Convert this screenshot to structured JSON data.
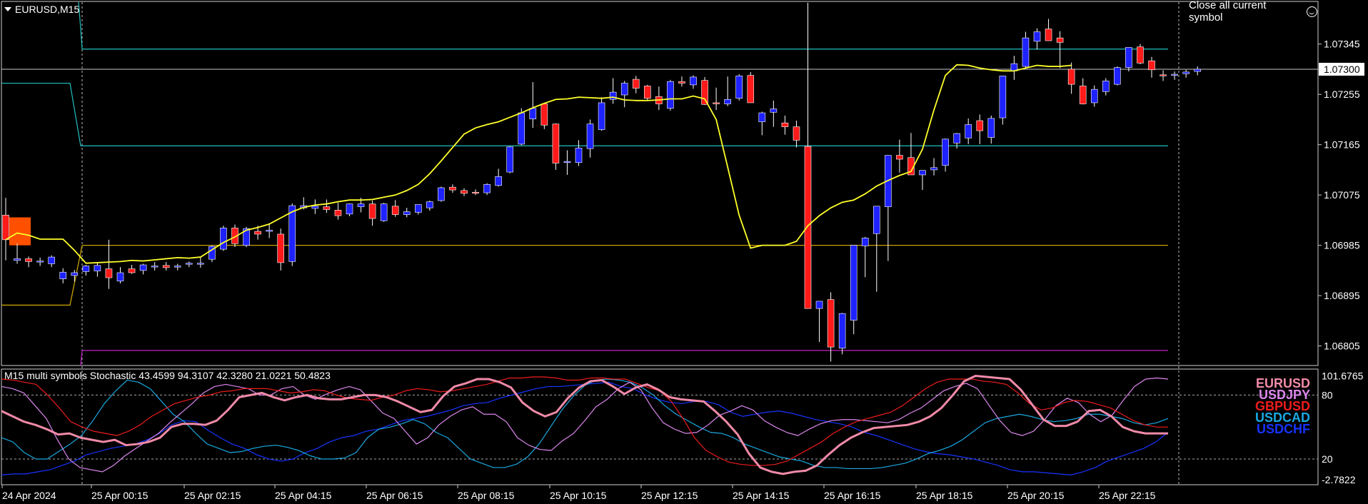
{
  "window": {
    "symbol_timeframe": "EURUSD,M15"
  },
  "toolbar": {
    "close_all_label": "Close all current symbol",
    "close_all_icon": "smiley-icon"
  },
  "price_axis": {
    "labels": [
      "1.07345",
      "1.07255",
      "1.07165",
      "1.07075",
      "1.06985",
      "1.06895",
      "1.06805"
    ],
    "current_price": "1.07300"
  },
  "time_axis": {
    "labels": [
      "24 Apr 2024",
      "25 Apr 00:15",
      "25 Apr 02:15",
      "25 Apr 04:15",
      "25 Apr 06:15",
      "25 Apr 08:15",
      "25 Apr 10:15",
      "25 Apr 12:15",
      "25 Apr 14:15",
      "25 Apr 16:15",
      "25 Apr 18:15",
      "25 Apr 20:15",
      "25 Apr 22:15"
    ]
  },
  "indicator": {
    "title": "M15 multi symbols Stochastic 43.4599 94.3107 42.3280 21.0221 50.4823",
    "axis_labels": [
      "101.6765",
      "80",
      "20",
      "-2.7822"
    ],
    "symbols": [
      {
        "name": "EURUSD",
        "color": "#f08aa8"
      },
      {
        "name": "USDJPY",
        "color": "#dd88ee"
      },
      {
        "name": "GBPUSD",
        "color": "#ee1c1c"
      },
      {
        "name": "USDCAD",
        "color": "#1aa8e0"
      },
      {
        "name": "USDCHF",
        "color": "#1733ff"
      }
    ]
  },
  "colors": {
    "bull": "#1e22ff",
    "bear": "#ff1a1a",
    "ma": "#ffff2a",
    "cyan": "#20c0c0",
    "gold": "#c8a000",
    "magenta": "#c020c0",
    "orange": "#ff5000"
  },
  "chart_data": {
    "type": "candlestick",
    "symbol": "EURUSD",
    "timeframe": "M15",
    "price_range": [
      1.0677,
      1.0742
    ],
    "candles_ohlc": [
      [
        1.07039,
        1.0707,
        1.06958,
        1.06995
      ],
      [
        1.06958,
        1.06988,
        1.06952,
        1.06961
      ],
      [
        1.06961,
        1.06965,
        1.06946,
        1.06956
      ],
      [
        1.06955,
        1.06963,
        1.06948,
        1.06957
      ],
      [
        1.06952,
        1.06967,
        1.06946,
        1.06964
      ],
      [
        1.06925,
        1.06944,
        1.06917,
        1.06937
      ],
      [
        1.06931,
        1.06941,
        1.0692,
        1.06936
      ],
      [
        1.06938,
        1.0695,
        1.06931,
        1.06948
      ],
      [
        1.06939,
        1.06954,
        1.06929,
        1.06949
      ],
      [
        1.06943,
        1.06995,
        1.06907,
        1.06927
      ],
      [
        1.06921,
        1.06946,
        1.06917,
        1.06936
      ],
      [
        1.06943,
        1.0695,
        1.06934,
        1.06936
      ],
      [
        1.0694,
        1.06952,
        1.06933,
        1.0695
      ],
      [
        1.06947,
        1.06955,
        1.0694,
        1.06948
      ],
      [
        1.06949,
        1.06955,
        1.0694,
        1.06945
      ],
      [
        1.06946,
        1.06952,
        1.0694,
        1.06948
      ],
      [
        1.06952,
        1.06956,
        1.06946,
        1.06953
      ],
      [
        1.06953,
        1.06964,
        1.06945,
        1.06953
      ],
      [
        1.0696,
        1.06985,
        1.06955,
        1.06983
      ],
      [
        1.06978,
        1.0702,
        1.06975,
        1.07016
      ],
      [
        1.07016,
        1.07022,
        1.06982,
        1.06988
      ],
      [
        1.06985,
        1.07018,
        1.06982,
        1.07015
      ],
      [
        1.0701,
        1.0702,
        1.06995,
        1.07005
      ],
      [
        1.0701,
        1.07023,
        1.06998,
        1.07012
      ],
      [
        1.07005,
        1.07015,
        1.0694,
        1.06954
      ],
      [
        1.06956,
        1.0706,
        1.06948,
        1.07056
      ],
      [
        1.07052,
        1.07071,
        1.07049,
        1.07056
      ],
      [
        1.07051,
        1.07067,
        1.07041,
        1.07055
      ],
      [
        1.07054,
        1.07067,
        1.07043,
        1.07049
      ],
      [
        1.07048,
        1.07061,
        1.07031,
        1.07038
      ],
      [
        1.07041,
        1.0706,
        1.07037,
        1.07059
      ],
      [
        1.07054,
        1.0707,
        1.07044,
        1.07059
      ],
      [
        1.07059,
        1.07065,
        1.0702,
        1.07033
      ],
      [
        1.07029,
        1.07061,
        1.07027,
        1.07059
      ],
      [
        1.07055,
        1.07066,
        1.07036,
        1.0704
      ],
      [
        1.0704,
        1.07052,
        1.07035,
        1.07045
      ],
      [
        1.07044,
        1.07058,
        1.0704,
        1.07058
      ],
      [
        1.07052,
        1.07065,
        1.07047,
        1.07063
      ],
      [
        1.07065,
        1.0709,
        1.07063,
        1.07088
      ],
      [
        1.07089,
        1.07094,
        1.07079,
        1.07084
      ],
      [
        1.07083,
        1.07087,
        1.07073,
        1.07078
      ],
      [
        1.0708,
        1.07085,
        1.07075,
        1.07079
      ],
      [
        1.07079,
        1.07096,
        1.07075,
        1.07094
      ],
      [
        1.07092,
        1.07122,
        1.0709,
        1.07108
      ],
      [
        1.07116,
        1.07162,
        1.07114,
        1.07161
      ],
      [
        1.07166,
        1.0723,
        1.07164,
        1.07222
      ],
      [
        1.07211,
        1.07277,
        1.07195,
        1.0723
      ],
      [
        1.07238,
        1.0724,
        1.07193,
        1.072
      ],
      [
        1.07202,
        1.07203,
        1.0712,
        1.07132
      ],
      [
        1.07133,
        1.07155,
        1.07111,
        1.07135
      ],
      [
        1.07133,
        1.07173,
        1.07127,
        1.07159
      ],
      [
        1.07158,
        1.0721,
        1.07142,
        1.07202
      ],
      [
        1.07192,
        1.0725,
        1.0719,
        1.0724
      ],
      [
        1.07246,
        1.07284,
        1.07238,
        1.07259
      ],
      [
        1.07254,
        1.07279,
        1.07232,
        1.07275
      ],
      [
        1.07282,
        1.07288,
        1.07257,
        1.07266
      ],
      [
        1.0727,
        1.07272,
        1.07244,
        1.07248
      ],
      [
        1.07251,
        1.07269,
        1.07227,
        1.07238
      ],
      [
        1.0723,
        1.07281,
        1.07226,
        1.07278
      ],
      [
        1.07278,
        1.07287,
        1.07269,
        1.07275
      ],
      [
        1.07272,
        1.07289,
        1.07265,
        1.07286
      ],
      [
        1.0728,
        1.07286,
        1.07236,
        1.07237
      ],
      [
        1.0724,
        1.07267,
        1.07227,
        1.07239
      ],
      [
        1.07238,
        1.07287,
        1.07234,
        1.07246
      ],
      [
        1.07248,
        1.07291,
        1.07244,
        1.07288
      ],
      [
        1.07289,
        1.07295,
        1.07241,
        1.0724
      ],
      [
        1.07206,
        1.07224,
        1.07182,
        1.07222
      ],
      [
        1.07223,
        1.07244,
        1.07197,
        1.07229
      ],
      [
        1.07204,
        1.07217,
        1.07183,
        1.07197
      ],
      [
        1.07197,
        1.07208,
        1.0716,
        1.07173
      ],
      [
        1.07162,
        1.07419,
        1.06913,
        1.06872
      ],
      [
        1.06872,
        1.06883,
        1.06812,
        1.06885
      ],
      [
        1.06888,
        1.06901,
        1.06777,
        1.06803
      ],
      [
        1.06801,
        1.06864,
        1.0679,
        1.06863
      ],
      [
        1.06851,
        1.06962,
        1.06826,
        1.06985
      ],
      [
        1.06984,
        1.07,
        1.06928,
        1.06998
      ],
      [
        1.07006,
        1.07011,
        1.06902,
        1.07055
      ],
      [
        1.07054,
        1.07079,
        1.06957,
        1.07146
      ],
      [
        1.07146,
        1.07174,
        1.07115,
        1.07139
      ],
      [
        1.07142,
        1.07186,
        1.07111,
        1.07111
      ],
      [
        1.07111,
        1.07119,
        1.07084,
        1.07119
      ],
      [
        1.0712,
        1.07141,
        1.0711,
        1.07124
      ],
      [
        1.07128,
        1.07176,
        1.07117,
        1.07175
      ],
      [
        1.07168,
        1.07186,
        1.07158,
        1.07185
      ],
      [
        1.07177,
        1.07212,
        1.07166,
        1.07201
      ],
      [
        1.07208,
        1.07219,
        1.07166,
        1.0719
      ],
      [
        1.07178,
        1.07217,
        1.07167,
        1.07212
      ],
      [
        1.07213,
        1.07237,
        1.07201,
        1.07288
      ],
      [
        1.07297,
        1.07324,
        1.07281,
        1.0731
      ],
      [
        1.07305,
        1.07367,
        1.07301,
        1.07356
      ],
      [
        1.0735,
        1.07373,
        1.07335,
        1.07367
      ],
      [
        1.07372,
        1.0739,
        1.07361,
        1.07351
      ],
      [
        1.07356,
        1.07368,
        1.07302,
        1.07348
      ],
      [
        1.073,
        1.07312,
        1.07256,
        1.07273
      ],
      [
        1.0727,
        1.07284,
        1.07237,
        1.07238
      ],
      [
        1.0724,
        1.07271,
        1.07233,
        1.07264
      ],
      [
        1.0726,
        1.07284,
        1.07253,
        1.07279
      ],
      [
        1.07273,
        1.07305,
        1.07271,
        1.07303
      ],
      [
        1.07303,
        1.07337,
        1.07296,
        1.07339
      ],
      [
        1.0734,
        1.07345,
        1.07309,
        1.07311
      ],
      [
        1.07315,
        1.07322,
        1.07285,
        1.07299
      ],
      [
        1.0729,
        1.07298,
        1.07279,
        1.07289
      ],
      [
        1.0729,
        1.07296,
        1.07281,
        1.07291
      ],
      [
        1.07292,
        1.07299,
        1.07285,
        1.07295
      ],
      [
        1.07296,
        1.07305,
        1.07289,
        1.073
      ]
    ],
    "moving_average": [
      1.06995,
      1.07007,
      1.07003,
      1.06996,
      1.06996,
      1.06996,
      1.06976,
      1.06953,
      1.06954,
      1.06955,
      1.06956,
      1.06958,
      1.06957,
      1.06959,
      1.06961,
      1.06963,
      1.06962,
      1.06964,
      1.06977,
      1.0699,
      1.07,
      1.07012,
      1.07017,
      1.07023,
      1.07034,
      1.07045,
      1.07053,
      1.07057,
      1.07059,
      1.07063,
      1.07066,
      1.07066,
      1.07067,
      1.07071,
      1.07075,
      1.07083,
      1.07094,
      1.07113,
      1.07136,
      1.0716,
      1.07184,
      1.07195,
      1.07201,
      1.07206,
      1.07214,
      1.07222,
      1.07231,
      1.07239,
      1.07246,
      1.07247,
      1.0725,
      1.07249,
      1.07248,
      1.0725,
      1.07245,
      1.07244,
      1.07244,
      1.07245,
      1.07247,
      1.07247,
      1.07252,
      1.07247,
      1.0721,
      1.07125,
      1.07039,
      1.0698,
      1.06985,
      1.06985,
      1.06985,
      1.06992,
      1.0702,
      1.07038,
      1.07052,
      1.07062,
      1.07066,
      1.07077,
      1.07091,
      1.07101,
      1.0711,
      1.07117,
      1.07157,
      1.07227,
      1.07289,
      1.07308,
      1.07307,
      1.07302,
      1.07299,
      1.07297,
      1.07297,
      1.07302,
      1.07307,
      1.07305,
      1.07305,
      1.07307
    ],
    "horizontal_levels": {
      "cyan_upper": 1.07336,
      "cyan_lower": 1.07163,
      "gold": 1.06985,
      "magenta": 1.06797
    },
    "stochastic_series": {
      "EURUSD": [
        65,
        60,
        55,
        52,
        48,
        43,
        44,
        40,
        38,
        36,
        38,
        33,
        34,
        36,
        40,
        50,
        53,
        53,
        52,
        56,
        66,
        78,
        80,
        82,
        78,
        75,
        78,
        80,
        77,
        76,
        76,
        78,
        80,
        80,
        78,
        74,
        69,
        64,
        66,
        79,
        88,
        91,
        95,
        95,
        92,
        87,
        73,
        65,
        60,
        64,
        77,
        87,
        93,
        94,
        88,
        81,
        87,
        90,
        85,
        78,
        76,
        75,
        74,
        65,
        55,
        43,
        25,
        12,
        8,
        6,
        8,
        9,
        14,
        24,
        33,
        40,
        45,
        49,
        50,
        51,
        52,
        55,
        60,
        68,
        80,
        93,
        98,
        97,
        96,
        95,
        85,
        71,
        57,
        51,
        51,
        55,
        65,
        66,
        60,
        50,
        46,
        44,
        44,
        44
      ],
      "USDJPY": [
        88,
        86,
        82,
        70,
        58,
        38,
        20,
        12,
        10,
        8,
        14,
        23,
        30,
        37,
        44,
        54,
        63,
        72,
        82,
        88,
        90,
        88,
        86,
        80,
        80,
        86,
        88,
        80,
        76,
        81,
        85,
        88,
        85,
        74,
        63,
        58,
        46,
        34,
        40,
        52,
        60,
        66,
        69,
        62,
        62,
        55,
        40,
        33,
        29,
        28,
        37,
        44,
        56,
        69,
        76,
        86,
        92,
        85,
        68,
        54,
        48,
        44,
        45,
        52,
        61,
        65,
        70,
        66,
        56,
        50,
        45,
        42,
        48,
        53,
        56,
        57,
        57,
        56,
        55,
        54,
        57,
        63,
        68,
        76,
        84,
        88,
        91,
        86,
        71,
        56,
        45,
        42,
        46,
        57,
        70,
        77,
        73,
        62,
        55,
        61,
        75,
        88,
        95,
        96,
        95
      ],
      "GBPUSD": [
        95,
        94,
        92,
        90,
        80,
        68,
        55,
        50,
        46,
        44,
        42,
        46,
        52,
        60,
        66,
        72,
        75,
        78,
        80,
        83,
        84,
        86,
        86,
        86,
        84,
        82,
        83,
        85,
        84,
        80,
        77,
        76,
        75,
        78,
        80,
        84,
        86,
        85,
        83,
        84,
        86,
        88,
        90,
        93,
        96,
        96,
        97,
        97,
        96,
        94,
        94,
        96,
        96,
        95,
        95,
        91,
        87,
        84,
        74,
        58,
        40,
        28,
        22,
        17,
        15,
        14,
        14,
        15,
        18,
        24,
        30,
        36,
        44,
        50,
        55,
        58,
        61,
        64,
        70,
        78,
        86,
        92,
        95,
        95,
        95,
        93,
        92,
        90,
        82,
        72,
        66,
        68,
        73,
        75,
        74,
        71,
        68,
        62,
        56,
        52,
        50,
        50
      ],
      "USDCAD": [
        40,
        36,
        26,
        20,
        20,
        27,
        34,
        42,
        56,
        72,
        84,
        94,
        92,
        86,
        74,
        62,
        55,
        44,
        34,
        30,
        26,
        27,
        30,
        32,
        33,
        31,
        28,
        23,
        20,
        20,
        21,
        26,
        40,
        48,
        50,
        53,
        57,
        53,
        45,
        40,
        30,
        20,
        16,
        12,
        12,
        15,
        22,
        34,
        50,
        66,
        79,
        89,
        94,
        95,
        94,
        92,
        87,
        80,
        70,
        62,
        56,
        50,
        45,
        44,
        40,
        34,
        30,
        26,
        22,
        20,
        18,
        14,
        12,
        12,
        11,
        11,
        11,
        12,
        14,
        16,
        20,
        25,
        28,
        32,
        38,
        46,
        54,
        58,
        60,
        62,
        60,
        57,
        55,
        56,
        58,
        62,
        62,
        60,
        58,
        54,
        52,
        54,
        58
      ],
      "USDCHF": [
        5,
        6,
        6,
        8,
        10,
        14,
        18,
        24,
        27,
        30,
        32,
        34,
        38,
        44,
        52,
        56,
        55,
        47,
        40,
        34,
        30,
        24,
        20,
        18,
        20,
        26,
        30,
        36,
        40,
        42,
        46,
        48,
        52,
        56,
        58,
        60,
        63,
        66,
        70,
        72,
        73,
        77,
        80,
        83,
        86,
        88,
        88,
        89,
        90,
        91,
        92,
        88,
        86,
        80,
        76,
        73,
        72,
        74,
        74,
        71,
        64,
        60,
        62,
        64,
        65,
        63,
        60,
        57,
        55,
        53,
        50,
        45,
        42,
        38,
        34,
        30,
        27,
        25,
        24,
        22,
        20,
        17,
        14,
        10,
        8,
        8,
        7,
        6,
        5,
        8,
        12,
        18,
        22,
        26,
        30,
        36,
        45
      ]
    }
  }
}
